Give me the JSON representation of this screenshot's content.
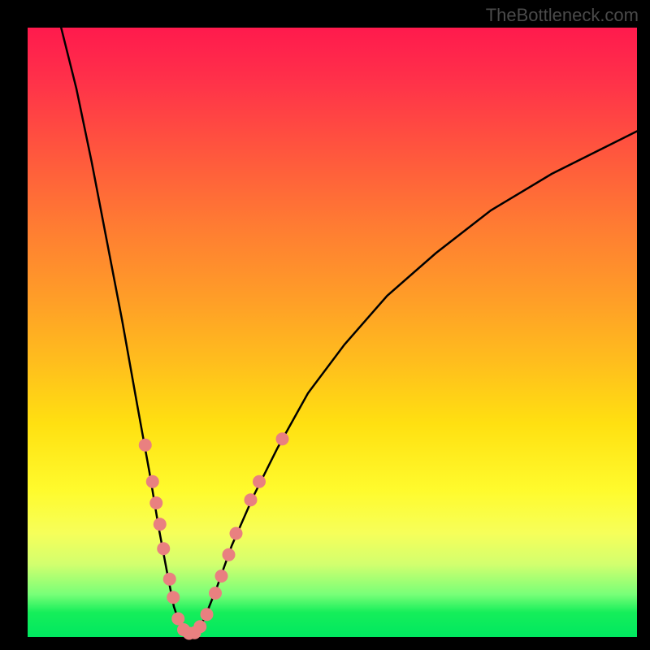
{
  "watermark": "TheBottleneck.com",
  "colors": {
    "curve": "#000000",
    "marker_fill": "#e98080",
    "marker_stroke": "#d86f6f"
  },
  "chart_data": {
    "type": "line",
    "title": "",
    "xlabel": "",
    "ylabel": "",
    "xlim": [
      0,
      100
    ],
    "ylim": [
      0,
      100
    ],
    "grid": false,
    "curve_left": [
      {
        "x": 5.5,
        "y": 100
      },
      {
        "x": 8.0,
        "y": 90
      },
      {
        "x": 10.5,
        "y": 78
      },
      {
        "x": 13.0,
        "y": 65
      },
      {
        "x": 15.5,
        "y": 52
      },
      {
        "x": 18.0,
        "y": 38
      },
      {
        "x": 20.0,
        "y": 27
      },
      {
        "x": 21.5,
        "y": 18
      },
      {
        "x": 23.0,
        "y": 10
      },
      {
        "x": 24.0,
        "y": 5
      },
      {
        "x": 25.0,
        "y": 2
      },
      {
        "x": 26.0,
        "y": 0.5
      }
    ],
    "curve_right": [
      {
        "x": 27.5,
        "y": 0.5
      },
      {
        "x": 29.0,
        "y": 3
      },
      {
        "x": 31.0,
        "y": 8
      },
      {
        "x": 33.5,
        "y": 15
      },
      {
        "x": 37.0,
        "y": 23
      },
      {
        "x": 41.0,
        "y": 31
      },
      {
        "x": 46.0,
        "y": 40
      },
      {
        "x": 52.0,
        "y": 48
      },
      {
        "x": 59.0,
        "y": 56
      },
      {
        "x": 67.0,
        "y": 63
      },
      {
        "x": 76.0,
        "y": 70
      },
      {
        "x": 86.0,
        "y": 76
      },
      {
        "x": 96.0,
        "y": 81
      },
      {
        "x": 100.0,
        "y": 83
      }
    ],
    "markers": [
      {
        "x": 19.3,
        "y": 31.5
      },
      {
        "x": 20.5,
        "y": 25.5
      },
      {
        "x": 21.1,
        "y": 22.0
      },
      {
        "x": 21.7,
        "y": 18.5
      },
      {
        "x": 22.3,
        "y": 14.5
      },
      {
        "x": 23.3,
        "y": 9.5
      },
      {
        "x": 23.9,
        "y": 6.5
      },
      {
        "x": 24.7,
        "y": 3.0
      },
      {
        "x": 25.6,
        "y": 1.2
      },
      {
        "x": 26.5,
        "y": 0.6
      },
      {
        "x": 27.4,
        "y": 0.7
      },
      {
        "x": 28.3,
        "y": 1.7
      },
      {
        "x": 29.4,
        "y": 3.7
      },
      {
        "x": 30.8,
        "y": 7.2
      },
      {
        "x": 31.8,
        "y": 10.0
      },
      {
        "x": 33.0,
        "y": 13.5
      },
      {
        "x": 34.2,
        "y": 17.0
      },
      {
        "x": 36.6,
        "y": 22.5
      },
      {
        "x": 38.0,
        "y": 25.5
      },
      {
        "x": 41.8,
        "y": 32.5
      }
    ],
    "marker_radius_px": 8
  }
}
